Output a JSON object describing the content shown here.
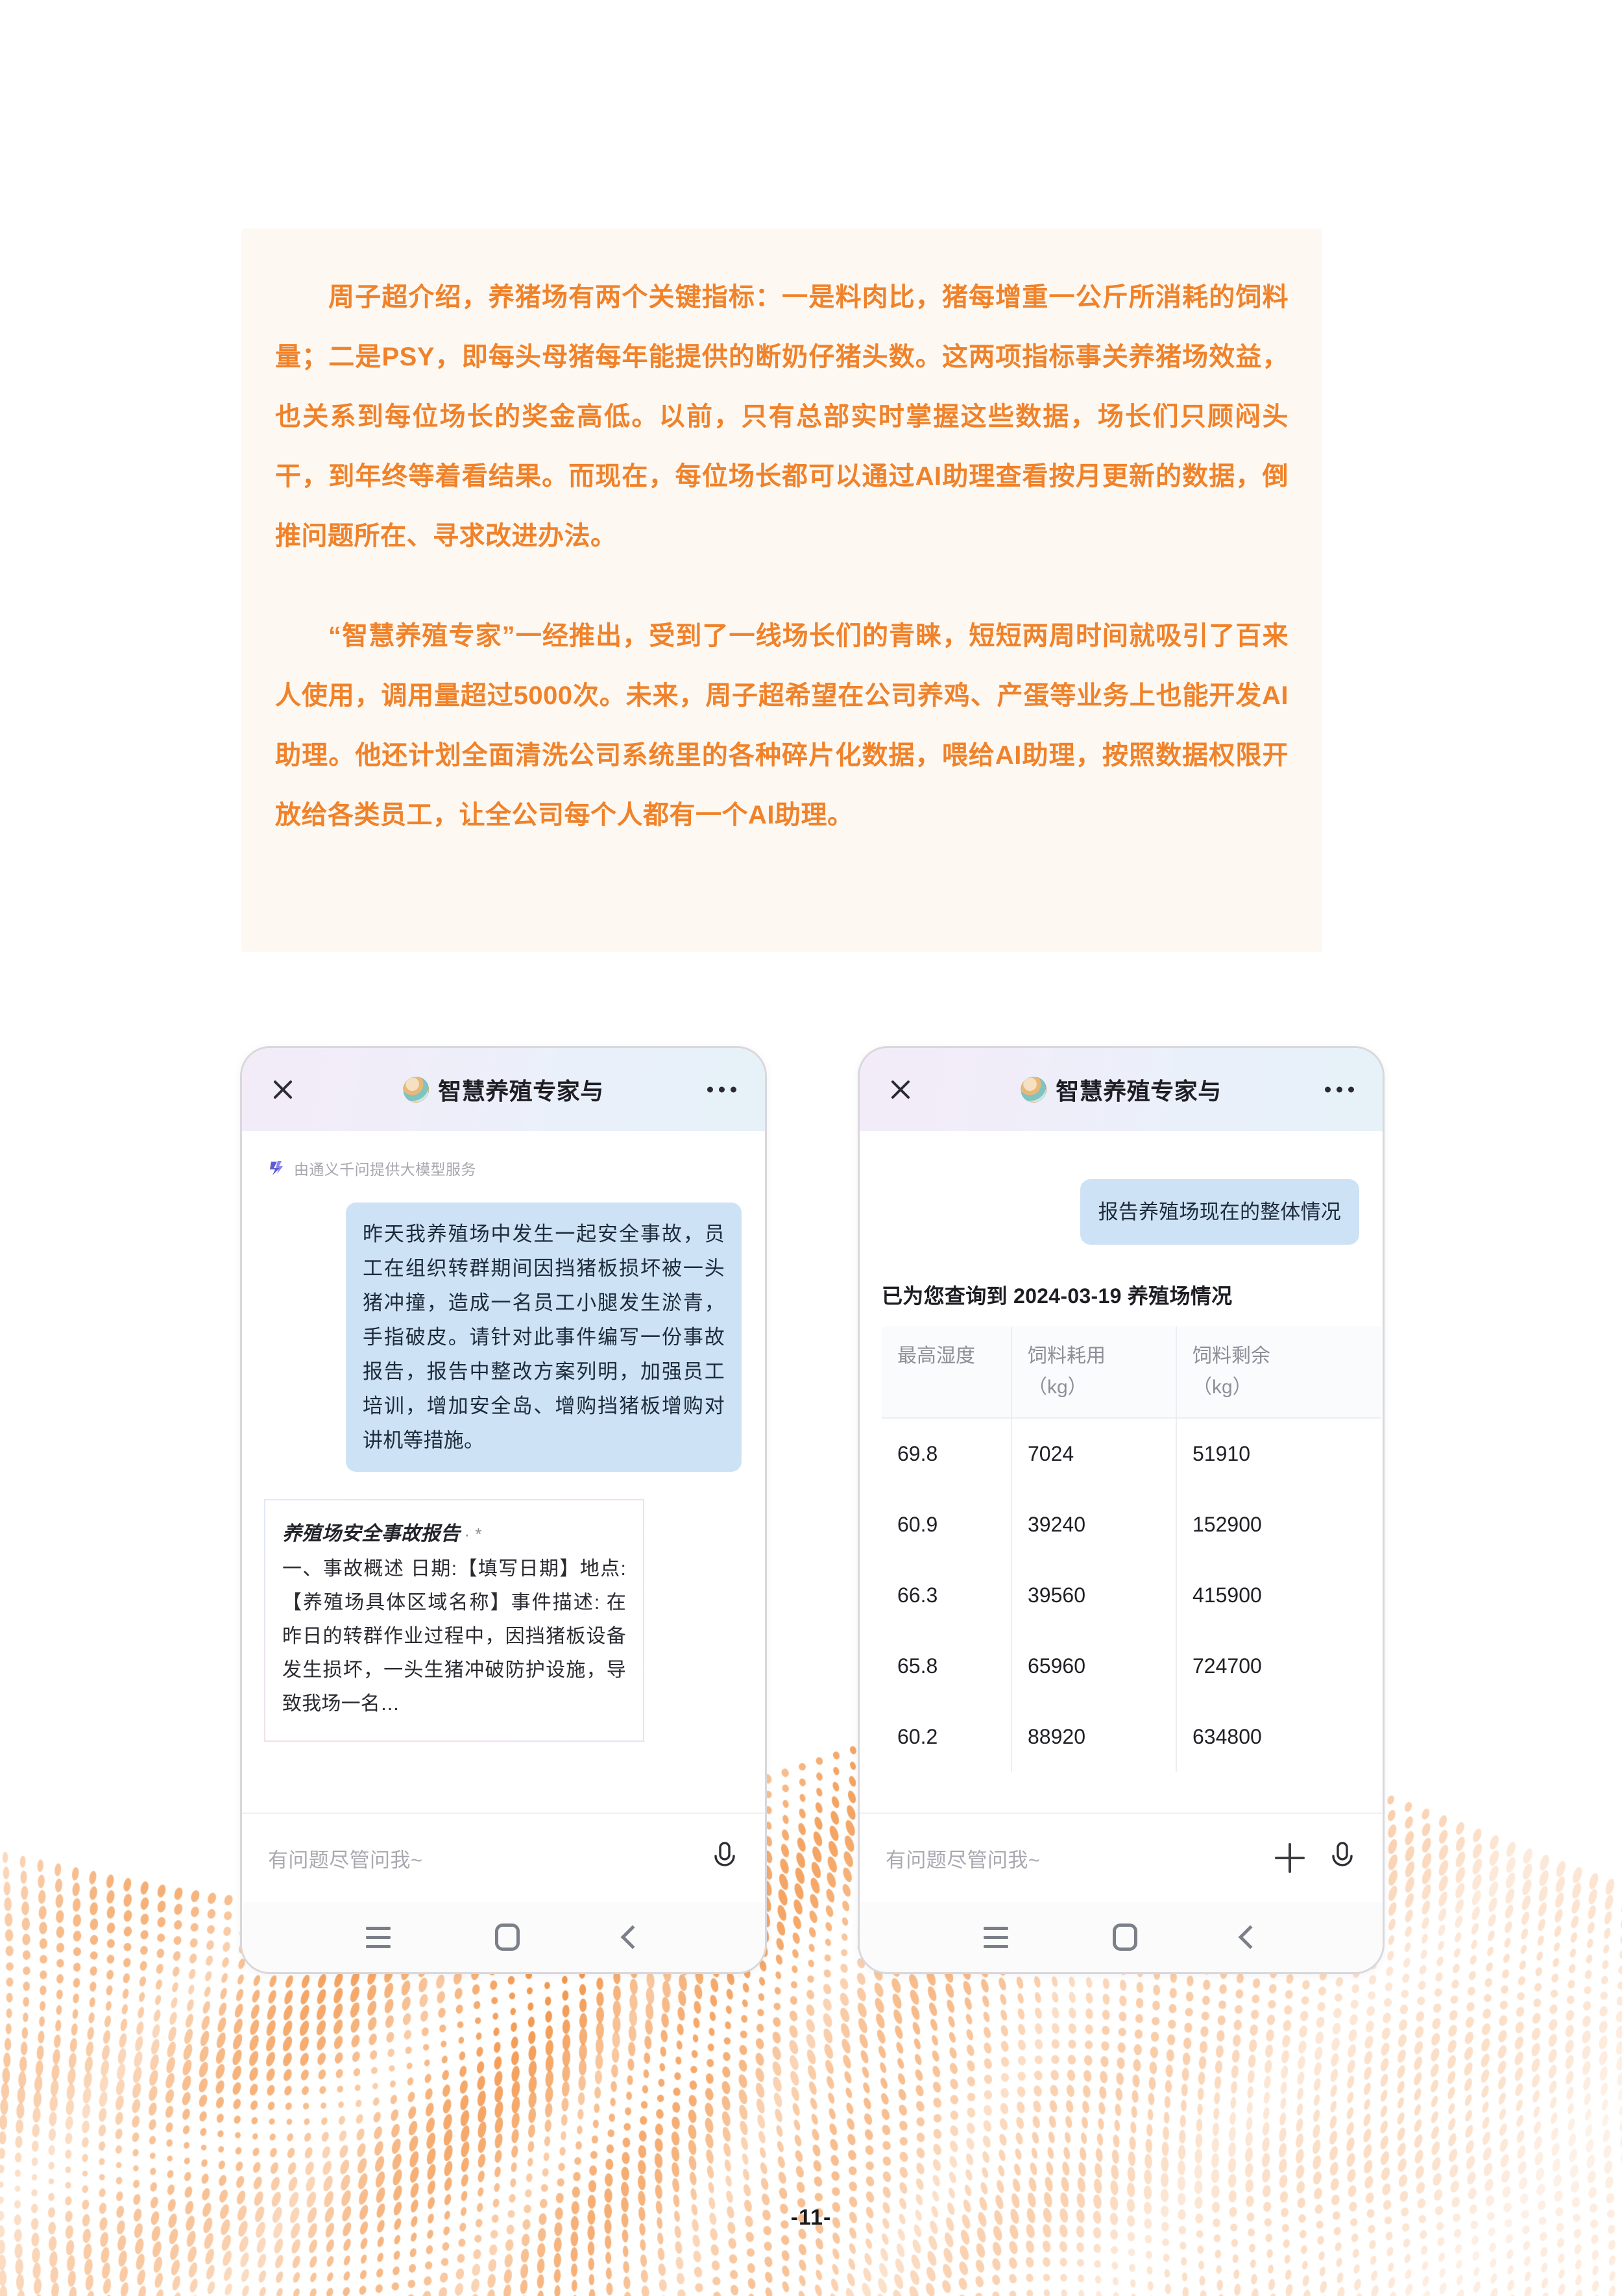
{
  "page": {
    "number_label": "-11-",
    "accent_color": "#f0822a",
    "article_bg": "#fdf8f2"
  },
  "article": {
    "paragraphs": [
      "周子超介绍，养猪场有两个关键指标：一是料肉比，猪每增重一公斤所消耗的饲料量；二是PSY，即每头母猪每年能提供的断奶仔猪头数。这两项指标事关养猪场效益，也关系到每位场长的奖金高低。以前，只有总部实时掌握这些数据，场长们只顾闷头干，到年终等着看结果。而现在，每位场长都可以通过AI助理查看按月更新的数据，倒推问题所在、寻求改进办法。",
      "“智慧养殖专家”一经推出，受到了一线场长们的青睐，短短两周时间就吸引了百来人使用，调用量超过5000次。未来，周子超希望在公司养鸡、产蛋等业务上也能开发AI助理。他还计划全面清洗公司系统里的各种碎片化数据，喂给AI助理，按照数据权限开放给各类员工，让全公司每个人都有一个AI助理。"
    ]
  },
  "phone_left": {
    "header": {
      "title": "智慧养殖专家与",
      "close_icon": "close-icon",
      "avatar_icon": "assistant-avatar",
      "more_icon": "more-options-icon"
    },
    "powered_by": "由通义千问提供大模型服务",
    "user_message": "昨天我养殖场中发生一起安全事故，员工在组织转群期间因挡猪板损坏被一头猪冲撞，造成一名员工小腿发生淤青，手指破皮。请针对此事件编写一份事故报告，报告中整改方案列明，加强员工培训，增加安全岛、增购挡猪板增购对讲机等措施。",
    "ai_card": {
      "title": "养殖场安全事故报告",
      "title_suffix": "· *",
      "body": "一、事故概述 日期:【填写日期】地点:【养殖场具体区域名称】事件描述: 在昨日的转群作业过程中，因挡猪板设备发生损坏，一头生猪冲破防护设施，导致我场一名…"
    },
    "input": {
      "placeholder": "有问题尽管问我~",
      "mic_icon": "microphone-icon"
    },
    "nav": {
      "recents_icon": "recents-icon",
      "home_icon": "home-icon",
      "back_icon": "back-icon"
    }
  },
  "phone_right": {
    "header": {
      "title": "智慧养殖专家与",
      "close_icon": "close-icon",
      "avatar_icon": "assistant-avatar",
      "more_icon": "more-options-icon"
    },
    "user_message": "报告养殖场现在的整体情况",
    "result": {
      "heading": "已为您查询到 2024-03-19 养殖场情况",
      "table": {
        "columns": [
          {
            "name": "最高湿度",
            "unit": ""
          },
          {
            "name": "饲料耗用",
            "unit": "（kg）"
          },
          {
            "name": "饲料剩余",
            "unit": "（kg）"
          }
        ],
        "rows": [
          [
            "69.8",
            "7024",
            "51910"
          ],
          [
            "60.9",
            "39240",
            "152900"
          ],
          [
            "66.3",
            "39560",
            "415900"
          ],
          [
            "65.8",
            "65960",
            "724700"
          ],
          [
            "60.2",
            "88920",
            "634800"
          ]
        ]
      }
    },
    "input": {
      "placeholder": "有问题尽管问我~",
      "plus_icon": "plus-icon",
      "mic_icon": "microphone-icon"
    },
    "nav": {
      "recents_icon": "recents-icon",
      "home_icon": "home-icon",
      "back_icon": "back-icon"
    }
  }
}
